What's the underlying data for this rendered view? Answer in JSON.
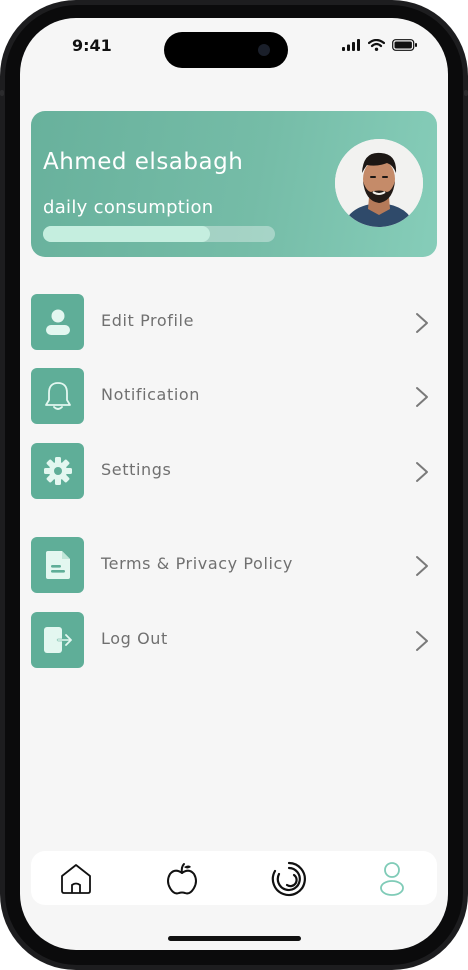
{
  "status_bar": {
    "time": "9:41"
  },
  "profile": {
    "name": "Ahmed elsabagh",
    "consumption_label": "daily consumption",
    "consumption_progress": 0.72
  },
  "menu": {
    "items": [
      {
        "label": "Edit Profile",
        "icon": "user-icon"
      },
      {
        "label": "Notification",
        "icon": "bell-icon"
      },
      {
        "label": "Settings",
        "icon": "gear-icon"
      },
      {
        "label": "Terms & Privacy Policy",
        "icon": "document-icon"
      },
      {
        "label": "Log Out",
        "icon": "logout-icon"
      }
    ]
  },
  "bottom_nav": {
    "items": [
      {
        "icon": "home-icon",
        "active": false
      },
      {
        "icon": "apple-icon",
        "active": false
      },
      {
        "icon": "progress-ring-icon",
        "active": false
      },
      {
        "icon": "profile-icon",
        "active": true
      }
    ]
  },
  "colors": {
    "accent": "#5fae98",
    "card_gradient_start": "#68b19c",
    "card_gradient_end": "#86cdb9",
    "progress_fill": "#c5eedf",
    "active_nav": "#7fcbb7"
  }
}
